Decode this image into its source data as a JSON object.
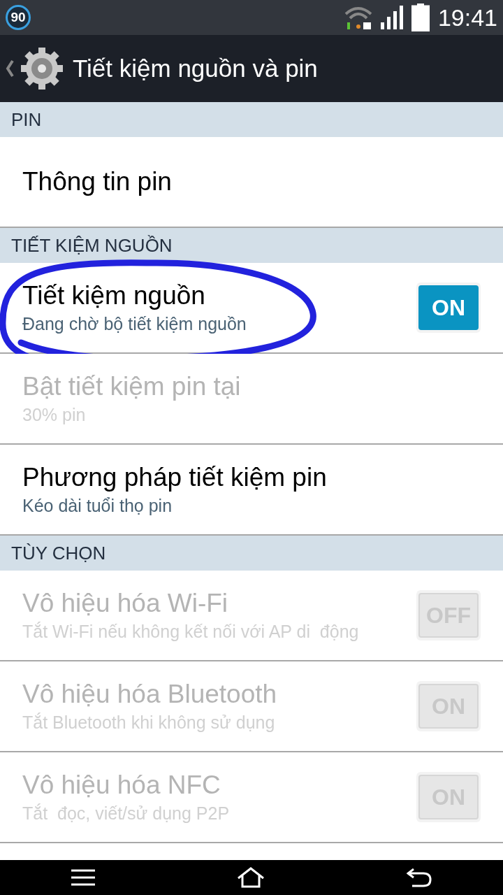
{
  "status_bar": {
    "badge": "90",
    "time": "19:41"
  },
  "header": {
    "title": "Tiết kiệm nguồn và pin"
  },
  "sections": [
    {
      "title": "PIN",
      "items": [
        {
          "kind": "plain",
          "title": "Thông tin pin",
          "disabled": false
        }
      ]
    },
    {
      "title": "TIẾT KIỆM NGUỒN",
      "items": [
        {
          "kind": "toggle",
          "title": "Tiết kiệm nguồn",
          "subtitle": "Đang chờ bộ tiết kiệm nguồn",
          "disabled": false,
          "toggle": "ON",
          "circled": true
        },
        {
          "kind": "plain",
          "title": "Bật tiết kiệm pin tại",
          "subtitle": "30% pin",
          "disabled": true
        },
        {
          "kind": "plain",
          "title": "Phương pháp tiết kiệm pin",
          "subtitle": "Kéo dài tuổi thọ pin",
          "disabled": false
        }
      ]
    },
    {
      "title": "TÙY CHỌN",
      "items": [
        {
          "kind": "toggle",
          "title": "Vô hiệu hóa Wi-Fi",
          "subtitle": "Tắt Wi-Fi nếu không kết nối với AP di  động",
          "disabled": true,
          "toggle": "OFF"
        },
        {
          "kind": "toggle",
          "title": "Vô hiệu hóa Bluetooth",
          "subtitle": "Tắt Bluetooth khi không sử dụng",
          "disabled": true,
          "toggle": "ON"
        },
        {
          "kind": "toggle",
          "title": "Vô hiệu hóa NFC",
          "subtitle": "Tắt  đọc, viết/sử dụng P2P",
          "disabled": true,
          "toggle": "ON"
        }
      ]
    }
  ]
}
